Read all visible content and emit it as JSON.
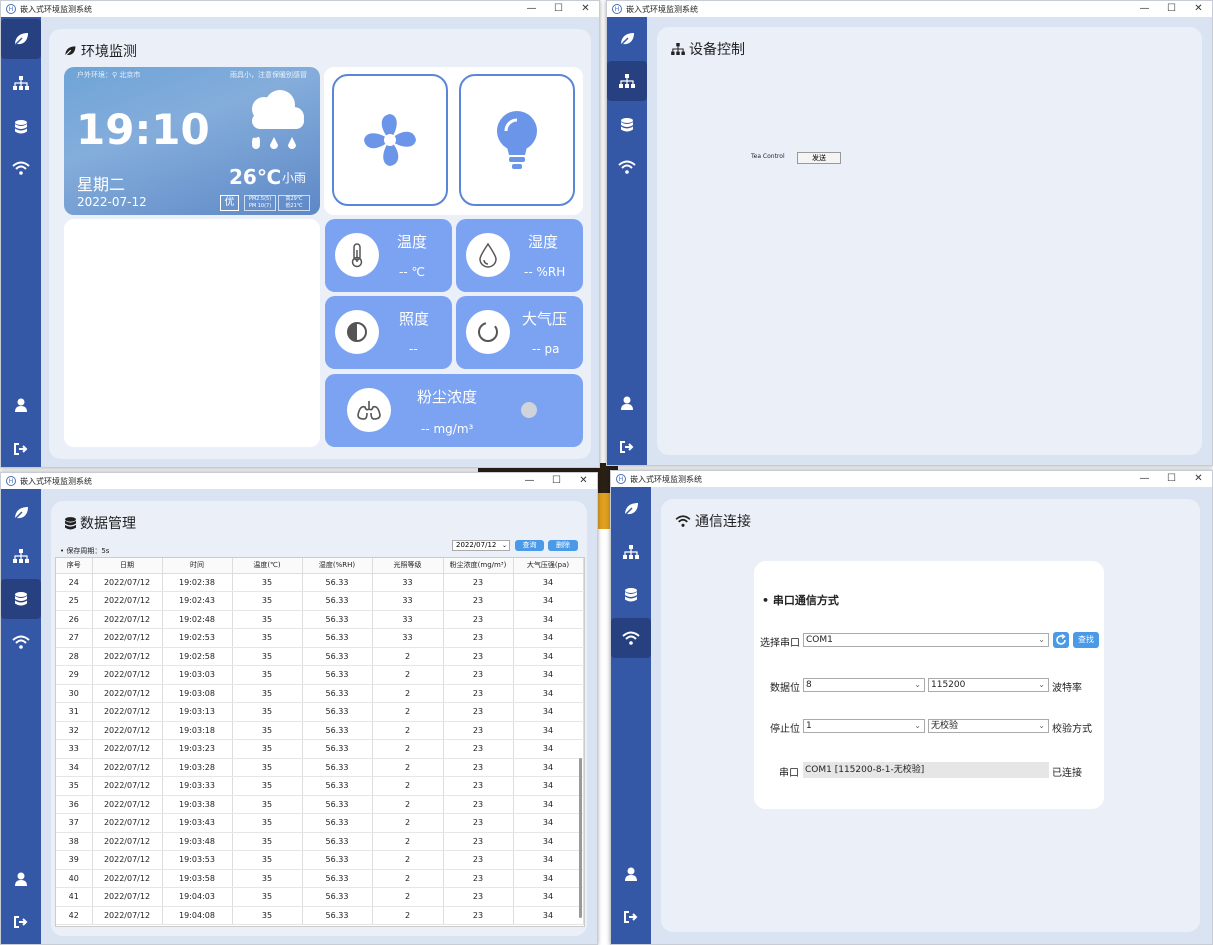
{
  "window_title": "嵌入式环境监测系统",
  "title_controls": [
    "—",
    "☐",
    "✕"
  ],
  "env": {
    "title": "环境监测",
    "weather": {
      "location": "户外环境：⚲ 北京市",
      "tip": "雨具小，注意保暖别感冒",
      "time": "19:10",
      "weekday": "星期二",
      "date": "2022-07-12",
      "temp": "26℃",
      "condition": "小雨",
      "aqi": "优",
      "pm_line1": "PM2.5(5)",
      "pm_line2": "PM 10(7)",
      "hl_line1": "高29℃",
      "hl_line2": "低21℃"
    },
    "cards": {
      "temp": {
        "label": "温度",
        "value": "-- ℃"
      },
      "humidity": {
        "label": "湿度",
        "value": "-- %RH"
      },
      "light": {
        "label": "照度",
        "value": "--"
      },
      "pressure": {
        "label": "大气压",
        "value": "-- pa"
      },
      "dust": {
        "label": "粉尘浓度",
        "value": "-- mg/m³"
      }
    }
  },
  "device": {
    "title": "设备控制",
    "label": "Tea Control",
    "button": "发送"
  },
  "data": {
    "title": "数据管理",
    "save_period": "• 保存周期：5s",
    "date": "2022/07/12",
    "query_btn": "查询",
    "delete_btn": "删除",
    "headers": [
      "序号",
      "日期",
      "时间",
      "温度(℃)",
      "湿度(%RH)",
      "光照等级",
      "粉尘浓度(mg/m³)",
      "大气压强(pa)"
    ],
    "rows": [
      [
        "24",
        "2022/07/12",
        "19:02:38",
        "35",
        "56.33",
        "33",
        "23",
        "34"
      ],
      [
        "25",
        "2022/07/12",
        "19:02:43",
        "35",
        "56.33",
        "33",
        "23",
        "34"
      ],
      [
        "26",
        "2022/07/12",
        "19:02:48",
        "35",
        "56.33",
        "33",
        "23",
        "34"
      ],
      [
        "27",
        "2022/07/12",
        "19:02:53",
        "35",
        "56.33",
        "33",
        "23",
        "34"
      ],
      [
        "28",
        "2022/07/12",
        "19:02:58",
        "35",
        "56.33",
        "2",
        "23",
        "34"
      ],
      [
        "29",
        "2022/07/12",
        "19:03:03",
        "35",
        "56.33",
        "2",
        "23",
        "34"
      ],
      [
        "30",
        "2022/07/12",
        "19:03:08",
        "35",
        "56.33",
        "2",
        "23",
        "34"
      ],
      [
        "31",
        "2022/07/12",
        "19:03:13",
        "35",
        "56.33",
        "2",
        "23",
        "34"
      ],
      [
        "32",
        "2022/07/12",
        "19:03:18",
        "35",
        "56.33",
        "2",
        "23",
        "34"
      ],
      [
        "33",
        "2022/07/12",
        "19:03:23",
        "35",
        "56.33",
        "2",
        "23",
        "34"
      ],
      [
        "34",
        "2022/07/12",
        "19:03:28",
        "35",
        "56.33",
        "2",
        "23",
        "34"
      ],
      [
        "35",
        "2022/07/12",
        "19:03:33",
        "35",
        "56.33",
        "2",
        "23",
        "34"
      ],
      [
        "36",
        "2022/07/12",
        "19:03:38",
        "35",
        "56.33",
        "2",
        "23",
        "34"
      ],
      [
        "37",
        "2022/07/12",
        "19:03:43",
        "35",
        "56.33",
        "2",
        "23",
        "34"
      ],
      [
        "38",
        "2022/07/12",
        "19:03:48",
        "35",
        "56.33",
        "2",
        "23",
        "34"
      ],
      [
        "39",
        "2022/07/12",
        "19:03:53",
        "35",
        "56.33",
        "2",
        "23",
        "34"
      ],
      [
        "40",
        "2022/07/12",
        "19:03:58",
        "35",
        "56.33",
        "2",
        "23",
        "34"
      ],
      [
        "41",
        "2022/07/12",
        "19:04:03",
        "35",
        "56.33",
        "2",
        "23",
        "34"
      ],
      [
        "42",
        "2022/07/12",
        "19:04:08",
        "35",
        "56.33",
        "2",
        "23",
        "34"
      ]
    ]
  },
  "comm": {
    "title": "通信连接",
    "section": "• 串口通信方式",
    "port_label": "选择串口",
    "port_value": "COM1",
    "open_btn": "查找",
    "databits_label": "数据位",
    "databits_value": "8",
    "baud_value": "115200",
    "baud_label": "波特率",
    "stopbits_label": "停止位",
    "stopbits_value": "1",
    "parity_value": "无校验",
    "parity_label": "校验方式",
    "serial_label": "串口",
    "serial_info": "COM1 [115200-8-1-无校验]",
    "status": "已连接"
  }
}
